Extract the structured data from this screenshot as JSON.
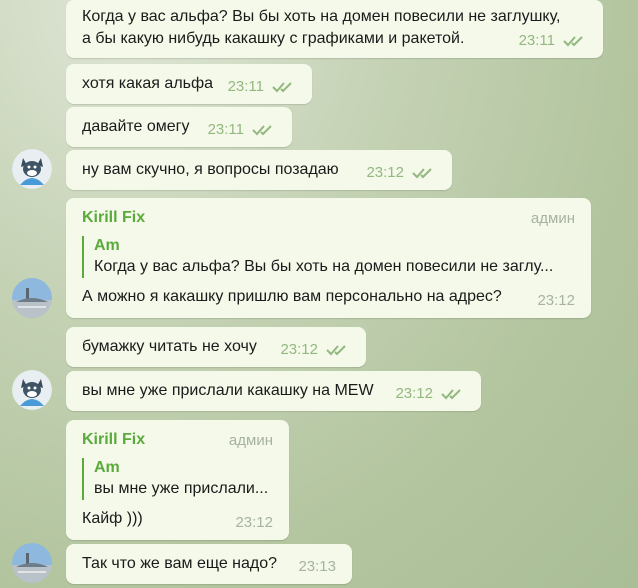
{
  "messages": [
    {
      "text": "Когда у вас альфа? Вы бы хоть на домен повесили не заглушку,\nа  бы какую нибудь какашку с графиками и ракетой.",
      "time": "23:11"
    },
    {
      "text": "хотя какая альфа",
      "time": "23:11"
    },
    {
      "text": "давайте омегу",
      "time": "23:11"
    },
    {
      "text": "ну вам скучно, я вопросы позадаю",
      "time": "23:12"
    },
    {
      "sender": "Kirill Fix",
      "role": "админ",
      "reply_name": "Am",
      "reply_text": "Когда у вас альфа? Вы бы хоть на домен повесили не заглу...",
      "text": "А можно я какашку пришлю вам персонально на адрес?",
      "time": "23:12"
    },
    {
      "text": "бумажку читать не хочу",
      "time": "23:12"
    },
    {
      "text": "вы мне уже прислали какашку на MEW",
      "time": "23:12"
    },
    {
      "sender": "Kirill Fix",
      "role": "админ",
      "reply_name": "Am",
      "reply_text": "вы мне уже прислали...",
      "text": "Кайф )))",
      "time": "23:12"
    },
    {
      "text": "Так что же вам еще надо?",
      "time": "23:13"
    }
  ],
  "colors": {
    "bubble": "#f4f9ea",
    "accent": "#5aaa3c",
    "time": "#93b87f"
  }
}
